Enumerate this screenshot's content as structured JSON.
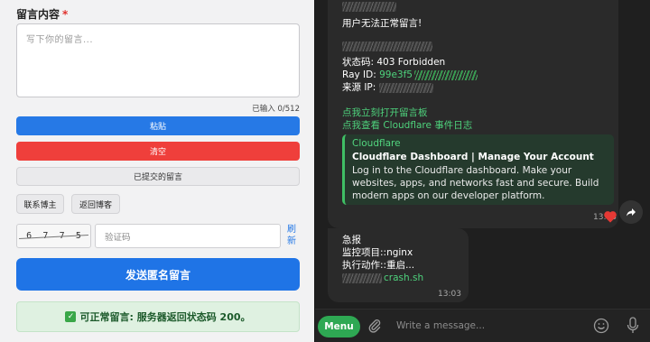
{
  "form": {
    "label": "留言内容",
    "required_mark": "*",
    "textarea_placeholder": "写下你的留言...",
    "counter": "已输入 0/512",
    "paste_label": "粘贴",
    "clear_label": "清空",
    "submitted_label": "已提交的留言",
    "contact_label": "联系博主",
    "back_label": "返回博客",
    "captcha": [
      "6",
      "7",
      "7",
      "5"
    ],
    "code_placeholder": "验证码",
    "refresh_label": "刷新",
    "send_label": "发送匿名留言",
    "status_text": "可正常留言: 服务器返回状态码 200。"
  },
  "chat": {
    "msg1": {
      "title": "用户无法正常留言!",
      "status_line": "状态码: 403 Forbidden",
      "ray_label": "Ray ID: ",
      "ray_value": "99e3f5",
      "source_label": "来源 IP:",
      "link1": "点我立刻打开留言板",
      "link2": "点我查看 Cloudflare 事件日志",
      "card_source": "Cloudflare",
      "card_title": "Cloudflare Dashboard | Manage Your Account",
      "card_desc": "Log in to the Cloudflare dashboard. Make your websites, apps, and networks fast and secure. Build modern apps on our developer platform.",
      "time": "13:03"
    },
    "msg2": {
      "title": "急报",
      "line1": "监控项目::nginx",
      "line2": "执行动作::重启...",
      "script": "crash.sh",
      "time": "13:03"
    },
    "input": {
      "menu_label": "Menu",
      "placeholder": "Write a message..."
    },
    "accent_color": "#2ea853",
    "reaction_color": "#e53935"
  }
}
